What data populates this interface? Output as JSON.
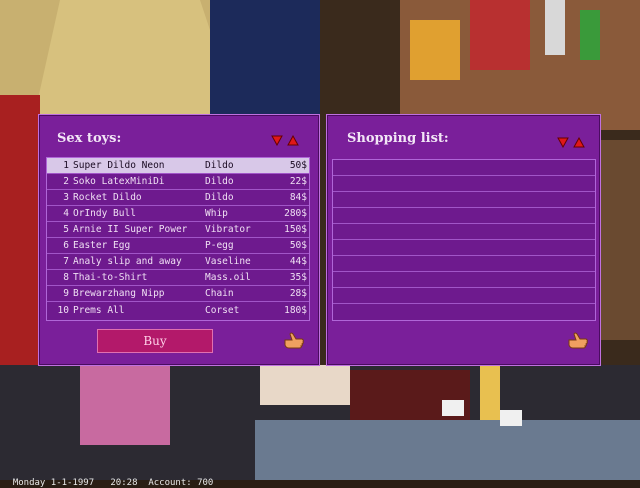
{
  "left_panel": {
    "title": "Sex toys:",
    "buy_label": "Buy",
    "items": [
      {
        "num": "1",
        "name": "Super Dildo Neon",
        "type": "Dildo",
        "price": "50$"
      },
      {
        "num": "2",
        "name": "Soko LatexMiniDi",
        "type": "Dildo",
        "price": "22$"
      },
      {
        "num": "3",
        "name": "Rocket Dildo",
        "type": "Dildo",
        "price": "84$"
      },
      {
        "num": "4",
        "name": "OrIndy Bull",
        "type": "Whip",
        "price": "280$"
      },
      {
        "num": "5",
        "name": "Arnie II Super Power",
        "type": "Vibrator",
        "price": "150$"
      },
      {
        "num": "6",
        "name": "Easter Egg",
        "type": "P-egg",
        "price": "50$"
      },
      {
        "num": "7",
        "name": "Analy slip and away",
        "type": "Vaseline",
        "price": "44$"
      },
      {
        "num": "8",
        "name": "Thai-to-Shirt",
        "type": "Mass.oil",
        "price": "35$"
      },
      {
        "num": "9",
        "name": "Brewarzhang Nipp",
        "type": "Chain",
        "price": "28$"
      },
      {
        "num": "10",
        "name": "Prems All",
        "type": "Corset",
        "price": "180$"
      }
    ]
  },
  "right_panel": {
    "title": "Shopping list:"
  },
  "status_bar": {
    "date": "Monday 1-1-1997",
    "time": "20:28",
    "account": "Account: 700"
  },
  "colors": {
    "panel": "#7a1f9a",
    "selected_row": "#d8c8e8",
    "buy_button": "#b3196a"
  }
}
